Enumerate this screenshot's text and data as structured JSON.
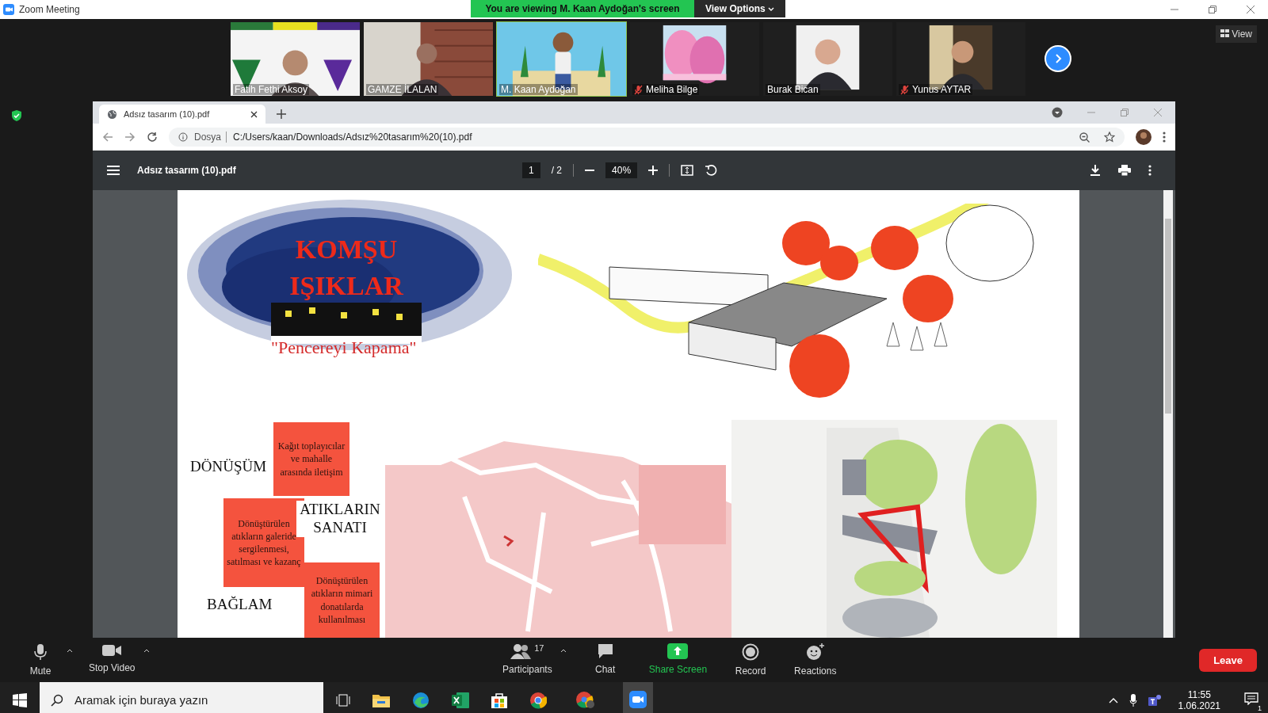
{
  "window": {
    "title": "Zoom Meeting"
  },
  "share_banner": {
    "text": "You are viewing M. Kaan Aydoğan's screen",
    "view_options": "View Options"
  },
  "view_button": "View",
  "participants": [
    {
      "name": "Fatih Fethi Aksoy",
      "muted": false,
      "active": false
    },
    {
      "name": "GAMZE İLALAN",
      "muted": false,
      "active": false
    },
    {
      "name": "M. Kaan Aydoğan",
      "muted": false,
      "active": true
    },
    {
      "name": "Meliha Bilge",
      "muted": true,
      "active": false
    },
    {
      "name": "Burak Bican",
      "muted": false,
      "active": false
    },
    {
      "name": "Yunus AYTAR",
      "muted": true,
      "active": false
    }
  ],
  "browser": {
    "tab_title": "Adsız tasarım (10).pdf",
    "address_prefix": "Dosya",
    "url": "C:/Users/kaan/Downloads/Adsız%20tasarım%20(10).pdf"
  },
  "pdf": {
    "title": "Adsız tasarım (10).pdf",
    "page": "1",
    "total": "/ 2",
    "zoom": "40%"
  },
  "slide": {
    "title_lines": [
      "KOMŞU",
      "IŞIKLAR"
    ],
    "subtitle": "\"Pencereyi Kapama\"",
    "labels": [
      "DÖNÜŞÜM",
      "ATIKLARIN SANATI",
      "BAĞLAM"
    ],
    "notes": [
      "Kağıt toplayıcılar ve mahalle arasında iletişim",
      "Dönüştürülen atıkların galeride sergilenmesi, satılması ve kazanç",
      "Dönüştürülen atıkların mimari donatılarda kullanılması"
    ]
  },
  "toolbar": {
    "left": [
      {
        "label": "Mute",
        "kind": "mic"
      },
      {
        "label": "Stop Video",
        "kind": "video"
      }
    ],
    "center": [
      {
        "label": "Participants",
        "kind": "people",
        "count": "17"
      },
      {
        "label": "Chat",
        "kind": "chat"
      },
      {
        "label": "Share Screen",
        "kind": "share"
      },
      {
        "label": "Record",
        "kind": "record"
      },
      {
        "label": "Reactions",
        "kind": "reactions"
      }
    ],
    "leave": "Leave"
  },
  "taskbar": {
    "search_placeholder": "Aramak için buraya yazın",
    "time": "11:55",
    "date": "1.06.2021",
    "notifications": "1"
  }
}
